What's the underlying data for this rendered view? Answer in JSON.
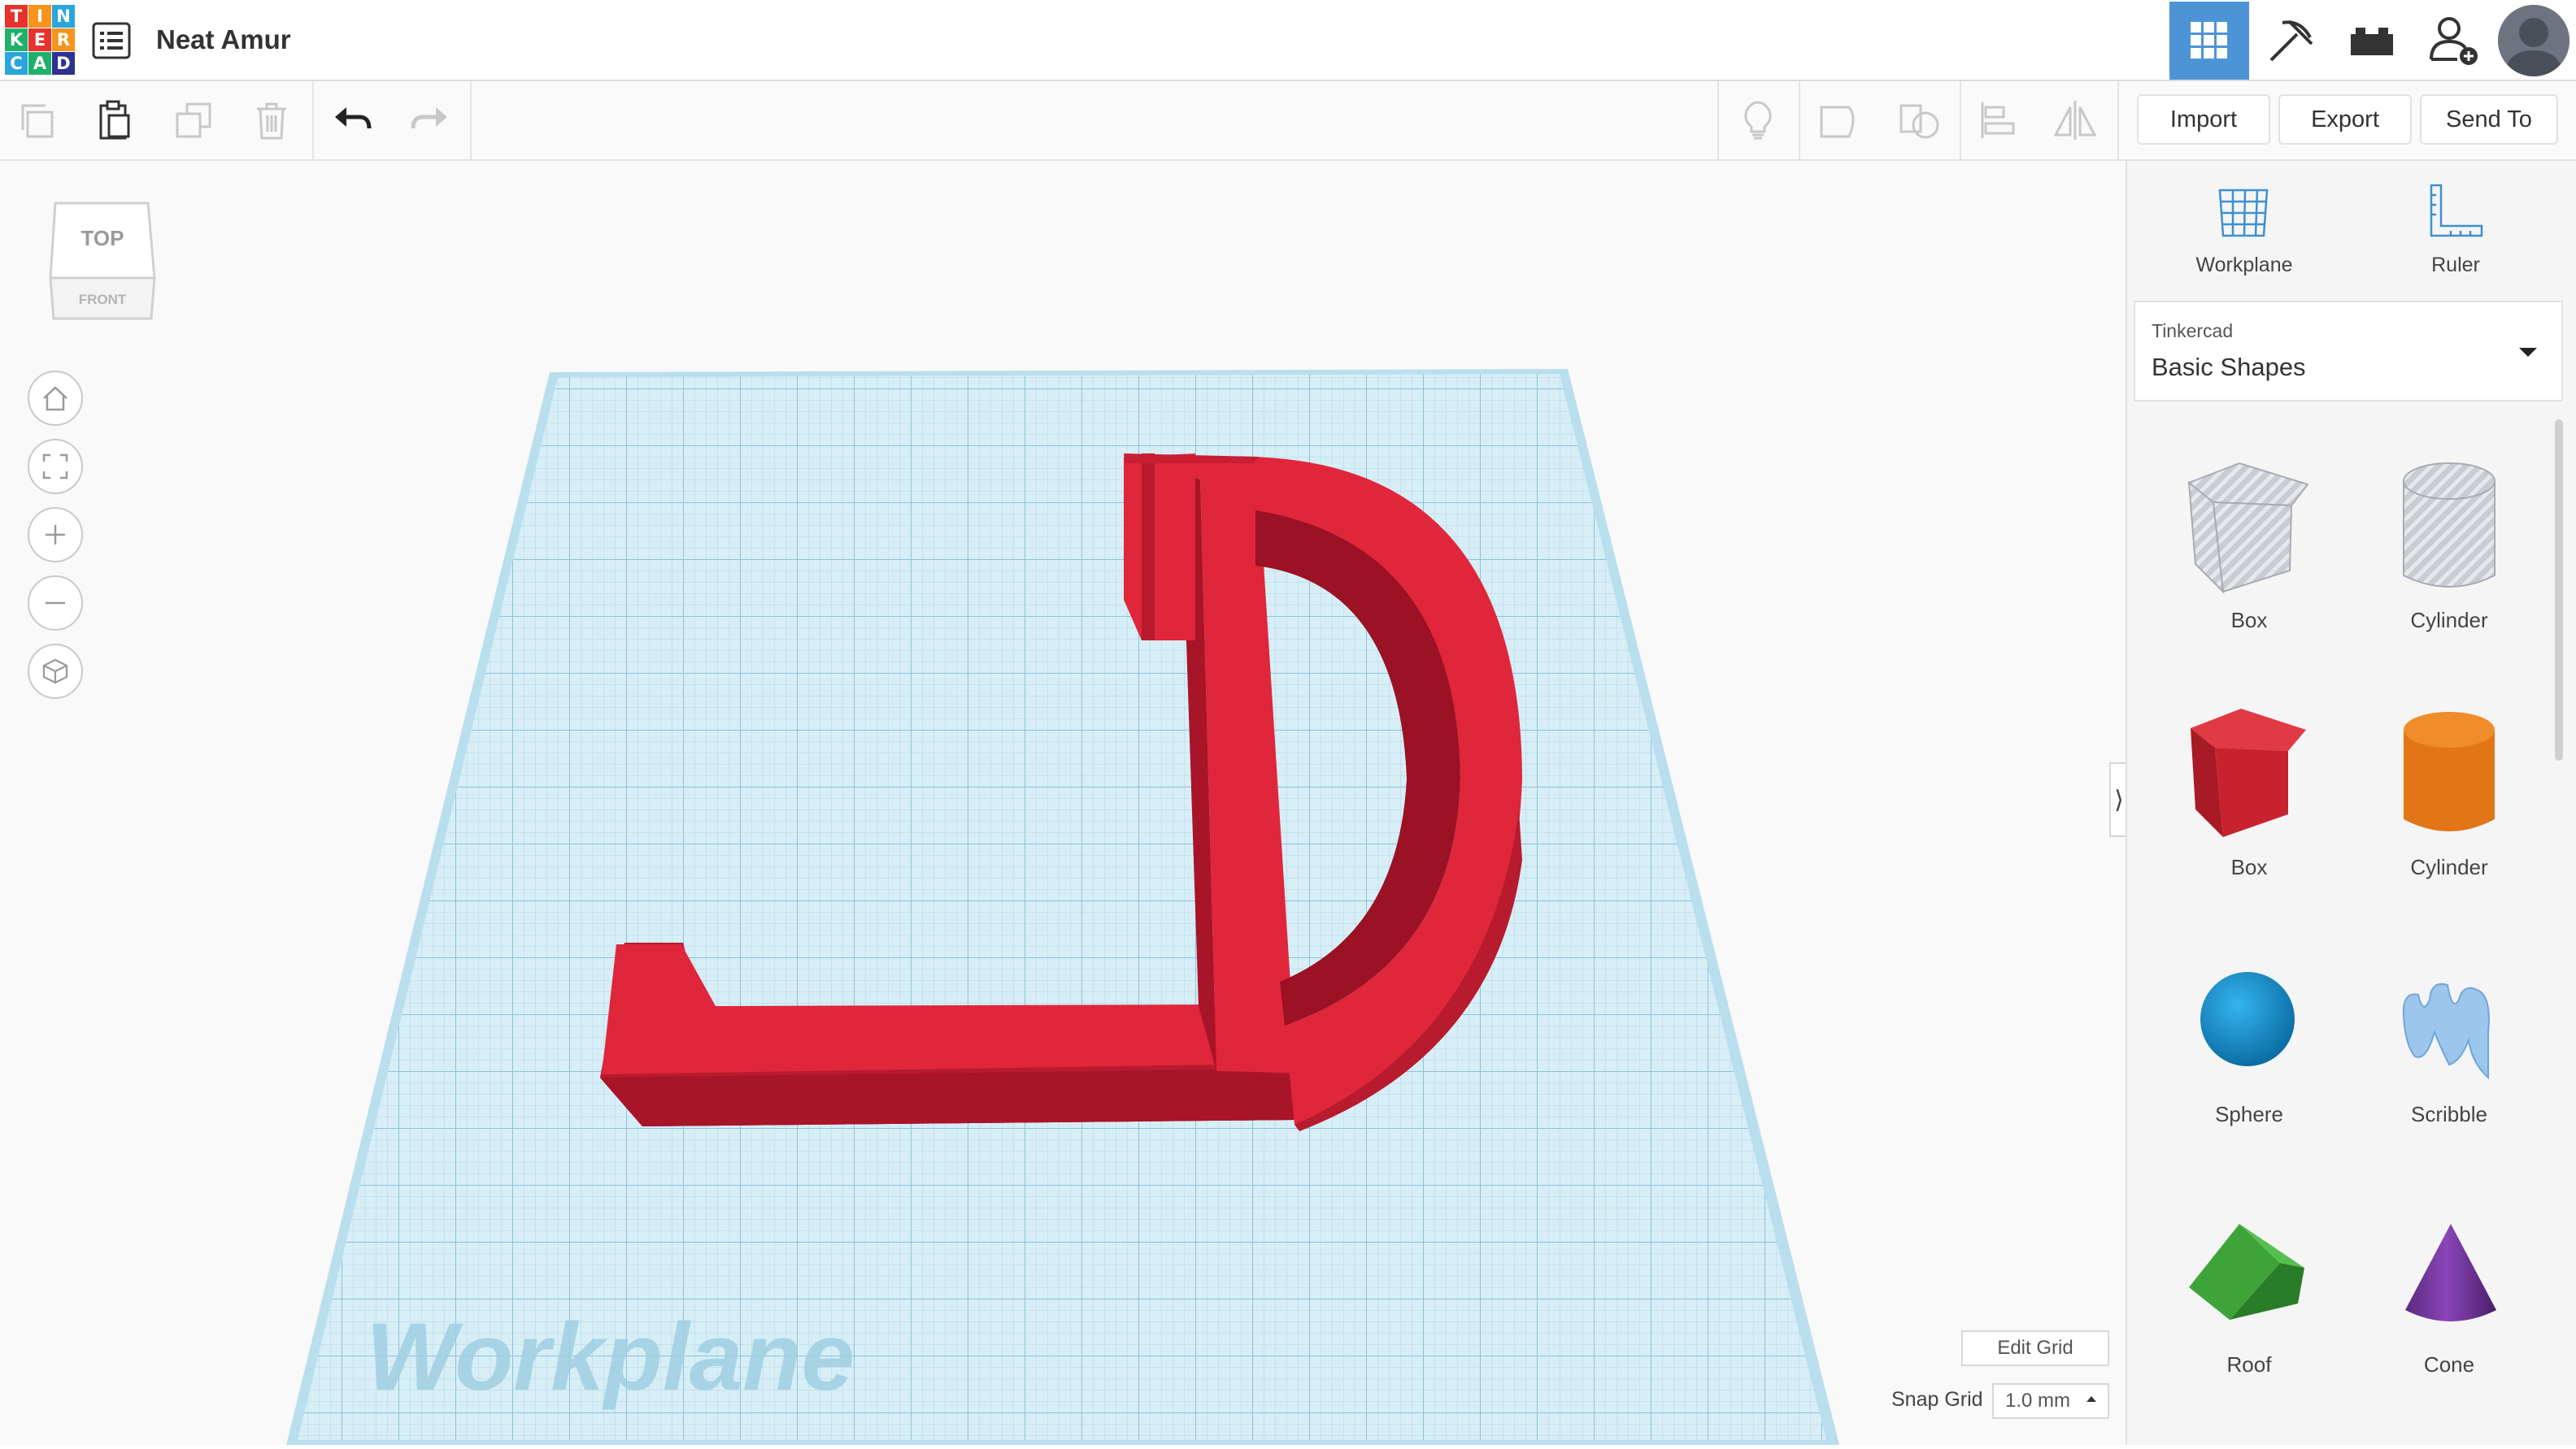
{
  "app": {
    "logo_letters": [
      "T",
      "I",
      "N",
      "K",
      "E",
      "R",
      "C",
      "A",
      "D"
    ],
    "logo_colors": [
      "#e8302c",
      "#f7941d",
      "#2aa6dc",
      "#1fb16a",
      "#e8302c",
      "#f7941d",
      "#2aa6dc",
      "#1fb16a",
      "#2e3191"
    ],
    "design_name": "Neat Amur"
  },
  "header": {
    "buttons": [
      {
        "name": "3d-design-icon",
        "active": true
      },
      {
        "name": "pickaxe-icon",
        "active": false
      },
      {
        "name": "bricks-icon",
        "active": false
      },
      {
        "name": "add-user-icon",
        "active": false
      }
    ],
    "accent": "#4d94d6"
  },
  "toolbar": {
    "import_label": "Import",
    "export_label": "Export",
    "sendto_label": "Send To"
  },
  "viewcube": {
    "top_label": "TOP",
    "front_label": "FRONT"
  },
  "canvas": {
    "workplane_watermark": "Workplane",
    "shape_color": "#e0263b",
    "grid_color": "#bfe3f0",
    "edit_grid_label": "Edit Grid",
    "snap_grid_label": "Snap Grid",
    "snap_grid_value": "1.0 mm"
  },
  "panel": {
    "tools": [
      {
        "label": "Workplane",
        "icon": "workplane-icon"
      },
      {
        "label": "Ruler",
        "icon": "ruler-icon"
      }
    ],
    "library": {
      "category": "Tinkercad",
      "name": "Basic Shapes"
    },
    "shapes": [
      {
        "label": "Box",
        "icon": "box-hole-icon"
      },
      {
        "label": "Cylinder",
        "icon": "cylinder-hole-icon"
      },
      {
        "label": "Box",
        "icon": "box-icon"
      },
      {
        "label": "Cylinder",
        "icon": "cylinder-icon"
      },
      {
        "label": "Sphere",
        "icon": "sphere-icon"
      },
      {
        "label": "Scribble",
        "icon": "scribble-icon"
      },
      {
        "label": "Roof",
        "icon": "roof-icon"
      },
      {
        "label": "Cone",
        "icon": "cone-icon"
      }
    ]
  }
}
